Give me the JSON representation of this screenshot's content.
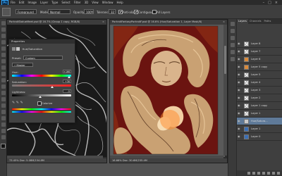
{
  "menu": {
    "app_logo": "Ps",
    "items": [
      "File",
      "Edit",
      "Image",
      "Layer",
      "Type",
      "Select",
      "Filter",
      "3D",
      "View",
      "Window",
      "Help"
    ]
  },
  "options": {
    "tool_icon": "brush-tool-icon",
    "preset_value": "Foreground",
    "mode_label": "Mode:",
    "mode_value": "Normal",
    "opacity_label": "Opacity:",
    "opacity_value": "100%",
    "tolerance_label": "Tolerance:",
    "tolerance_value": "32",
    "anti_alias_label": "Anti-alias",
    "anti_alias_checked": true,
    "contiguous_label": "Contiguous",
    "contiguous_checked": true,
    "all_layers_label": "All Layers",
    "all_layers_checked": false
  },
  "left_document": {
    "title": "PortraitStatueMeet.psd @ 16.7% (Group 1 copy, RGB/8)",
    "footer": "73.45%   Doc: 5.08M/154.8M"
  },
  "right_document": {
    "title": "PortraitFantasyPortraitF.psd @ 16.6% (Hue/Saturation 1, Layer Mask/8)",
    "footer": "16.66%   Doc: 30.6M/235.4M"
  },
  "properties": {
    "header": "Properties",
    "adjustment_name": "Hue/Saturation",
    "preset_label": "Preset:",
    "preset_value": "Custom",
    "channel_value": "Master",
    "hue_label": "Hue:",
    "hue_value": "+166",
    "hue_level": 0.96,
    "saturation_label": "Saturation:",
    "saturation_value": "+36",
    "saturation_level": 0.68,
    "lightness_label": "Lightness:",
    "lightness_value": "-5",
    "lightness_level": 0.48,
    "colorize_label": "Colorize",
    "colorize_checked": false
  },
  "layers_panel": {
    "tabs": [
      "Layers",
      "Channels",
      "Paths"
    ],
    "active_tab": "Layers",
    "rows": [
      {
        "name": "Layer 8",
        "thumb": "checker"
      },
      {
        "name": "Layer 7",
        "thumb": "checker"
      },
      {
        "name": "Layer 6",
        "thumb": "orange"
      },
      {
        "name": "Layer 5 copy",
        "thumb": "orange"
      },
      {
        "name": "Layer 5",
        "thumb": "checker"
      },
      {
        "name": "Layer 4",
        "thumb": "checker"
      },
      {
        "name": "Layer 3",
        "thumb": "checker"
      },
      {
        "name": "Layer 2",
        "thumb": "checker"
      },
      {
        "name": "Layer 1 copy",
        "thumb": "checker"
      },
      {
        "name": "Layer 1",
        "thumb": "checker"
      },
      {
        "name": "Hue/Satura...",
        "thumb": "adjustment",
        "selected": true
      },
      {
        "name": "Layer 1",
        "thumb": "blue"
      },
      {
        "name": "Layer 0",
        "thumb": "blue"
      }
    ]
  },
  "colors": {
    "accent_selected_layer": "#5f7a99",
    "ps_blue": "#31a8ff"
  }
}
